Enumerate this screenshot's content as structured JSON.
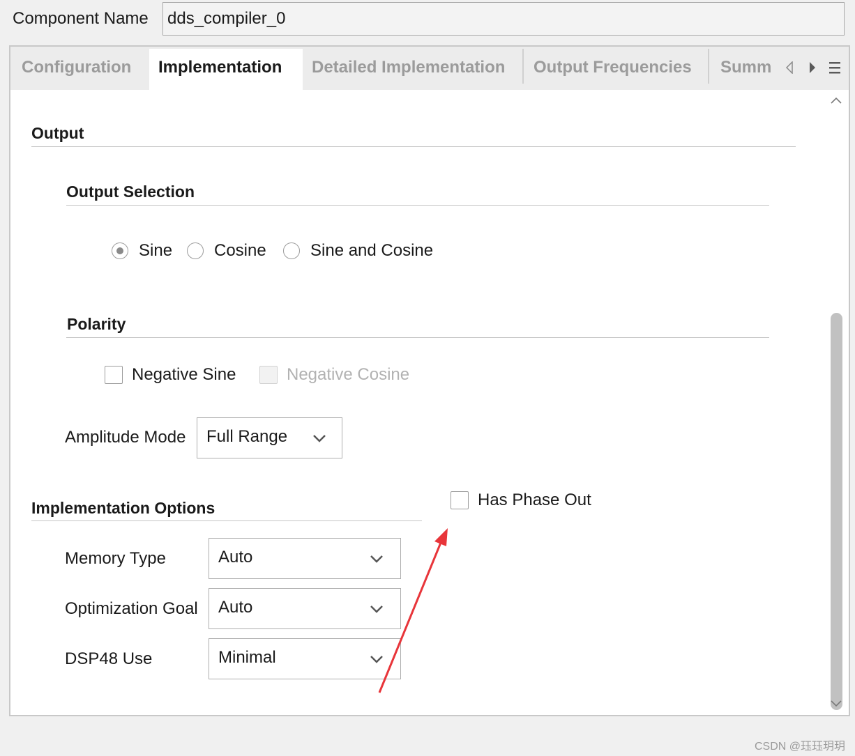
{
  "component": {
    "label": "Component Name",
    "value": "dds_compiler_0"
  },
  "tabs": [
    {
      "label": "Configuration",
      "active": false
    },
    {
      "label": "Implementation",
      "active": true
    },
    {
      "label": "Detailed Implementation",
      "active": false
    },
    {
      "label": "Output Frequencies",
      "active": false
    },
    {
      "label": "Summ",
      "active": false
    }
  ],
  "sections": {
    "output": "Output",
    "output_selection": "Output Selection",
    "polarity": "Polarity",
    "implementation_options": "Implementation Options"
  },
  "output_selection": {
    "options": [
      "Sine",
      "Cosine",
      "Sine and Cosine"
    ],
    "selected": "Sine"
  },
  "polarity": {
    "negative_sine": {
      "label": "Negative Sine",
      "checked": false,
      "enabled": true
    },
    "negative_cosine": {
      "label": "Negative Cosine",
      "checked": false,
      "enabled": false
    }
  },
  "amplitude_mode": {
    "label": "Amplitude Mode",
    "value": "Full Range"
  },
  "has_phase_out": {
    "label": "Has Phase Out",
    "checked": false
  },
  "impl_options": {
    "memory_type": {
      "label": "Memory Type",
      "value": "Auto"
    },
    "optimization_goal": {
      "label": "Optimization Goal",
      "value": "Auto"
    },
    "dsp48_use": {
      "label": "DSP48 Use",
      "value": "Minimal"
    }
  },
  "annotation_color": "#e8353a",
  "watermark": "CSDN @珏珏玥玥"
}
